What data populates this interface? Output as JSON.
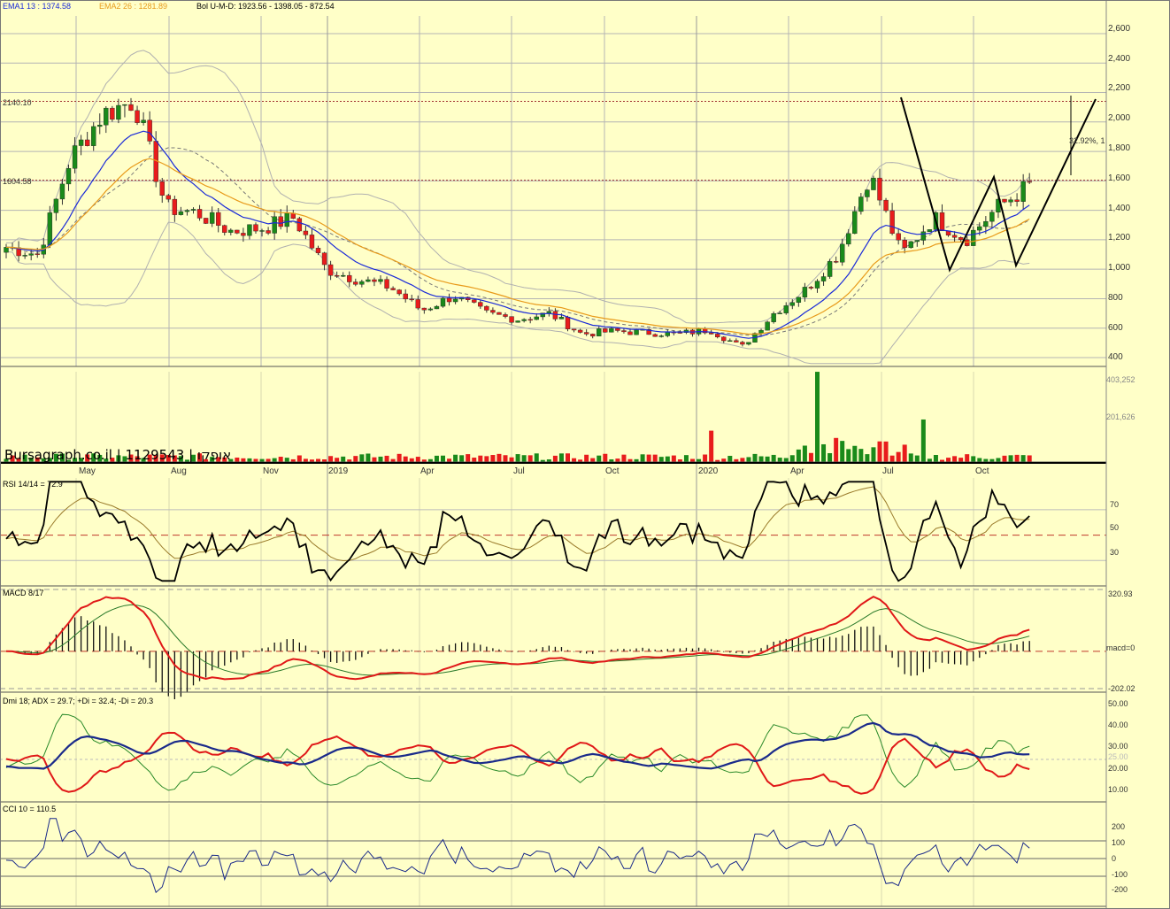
{
  "header": {
    "ema1": "EMA1 13 : 1374.58",
    "ema2": "EMA2 26 : 1281.89",
    "bol": "Bol U-M-D: 1923.56 - 1398.05 - 872.54"
  },
  "watermark": "Bursagraph.co.il | 1129543 | אופקו",
  "price_levels": {
    "upper": "2140.10",
    "lower": "1604.58"
  },
  "pattern_label": "32.92%, 1",
  "price_ticks": [
    "2,600",
    "2,400",
    "2,200",
    "2,000",
    "1,800",
    "1,600",
    "1,400",
    "1,200",
    "1,000",
    "800",
    "600",
    "400"
  ],
  "volume_ticks": [
    "403,252",
    "201,626"
  ],
  "months": [
    "May",
    "Aug",
    "Nov",
    "2019",
    "Apr",
    "Jul",
    "Oct",
    "2020",
    "Apr",
    "Jul",
    "Oct"
  ],
  "rsi": {
    "label": "RSI 14/14 = 72.9",
    "ticks": [
      "70",
      "50",
      "30"
    ]
  },
  "macd": {
    "label": "MACD 8/17",
    "ticks": [
      "320.93",
      "macd=0",
      "-202.02"
    ]
  },
  "dmi": {
    "label": "Dmi 18; ADX = 29.7; +Di = 32.4; -Di = 20.3",
    "ticks": [
      "50.00",
      "40.00",
      "30.00",
      "25.00",
      "20.00",
      "10.00"
    ]
  },
  "cci": {
    "label": "CCI 10 = 110.5",
    "ticks": [
      "200",
      "100",
      "0",
      "-100",
      "-200"
    ]
  },
  "colors": {
    "bg": "#ffffc8",
    "up": "#1a8a1a",
    "down": "#e81c1c",
    "ema1": "#1a2ad8",
    "ema2": "#e89a1a",
    "bol": "#b0b0b0",
    "grid": "#b4b4b4",
    "adx": "#1a2a8a"
  },
  "chart_data": {
    "type": "candlestick",
    "x": [
      "2018-04",
      "2018-05",
      "2018-06",
      "2018-07",
      "2018-08",
      "2018-09",
      "2018-10",
      "2018-11",
      "2018-12",
      "2019-01",
      "2019-02",
      "2019-03",
      "2019-04",
      "2019-05",
      "2019-06",
      "2019-07",
      "2019-08",
      "2019-09",
      "2019-10",
      "2019-11",
      "2019-12",
      "2020-01",
      "2020-02",
      "2020-03",
      "2020-04",
      "2020-05",
      "2020-06",
      "2020-07",
      "2020-08",
      "2020-09",
      "2020-10",
      "2020-11",
      "2020-12"
    ],
    "close": [
      1150,
      1100,
      1750,
      2050,
      2150,
      1420,
      1380,
      1260,
      1280,
      1350,
      1000,
      930,
      880,
      720,
      820,
      700,
      660,
      700,
      560,
      580,
      570,
      560,
      590,
      470,
      700,
      860,
      1100,
      1650,
      1100,
      1350,
      1200,
      1420,
      1570
    ],
    "ylim": [
      340,
      2720
    ],
    "last": {
      "ema1": 1374.58,
      "ema2": 1281.89,
      "bol_upper": 1923.56,
      "bol_mid": 1398.05,
      "bol_lower": 872.54,
      "rsi": 72.9,
      "adx": 29.7,
      "plus_di": 32.4,
      "minus_di": 20.3,
      "cci": 110.5
    },
    "volume_max": 403252,
    "macd_range": [
      -202.02,
      320.93
    ]
  }
}
